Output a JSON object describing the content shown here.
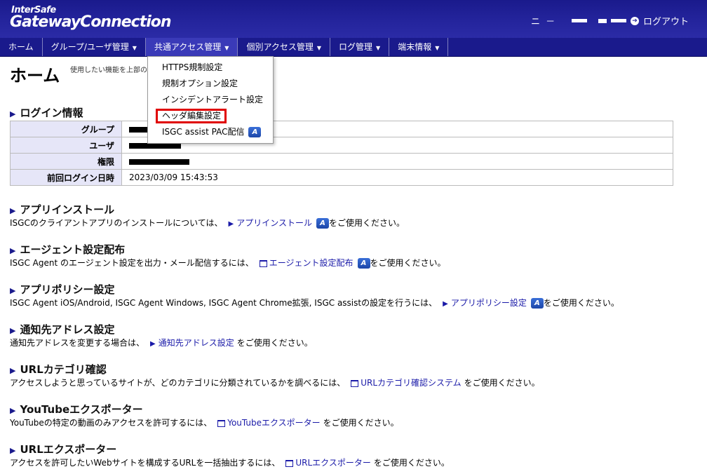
{
  "header": {
    "logo_top": "InterSafe",
    "logo_main": "GatewayConnection",
    "user_text": "ニ －",
    "logout": "ログアウト"
  },
  "nav": {
    "items": [
      {
        "label": "ホーム"
      },
      {
        "label": "グループ/ユーザ管理"
      },
      {
        "label": "共通アクセス管理"
      },
      {
        "label": "個別アクセス管理"
      },
      {
        "label": "ログ管理"
      },
      {
        "label": "端末情報"
      }
    ]
  },
  "dropdown": {
    "items": [
      {
        "label": "HTTPS規制設定"
      },
      {
        "label": "規制オプション設定"
      },
      {
        "label": "インシデントアラート設定"
      },
      {
        "label": "ヘッダ編集設定"
      },
      {
        "label": "ISGC assist PAC配信"
      }
    ]
  },
  "page": {
    "title": "ホーム",
    "desc": "使用したい機能を上部のメ"
  },
  "login": {
    "heading": "ログイン情報",
    "rows": [
      {
        "label": "グループ",
        "value": ""
      },
      {
        "label": "ユーザ",
        "value": ""
      },
      {
        "label": "権限",
        "value": ""
      },
      {
        "label": "前回ログイン日時",
        "value": "2023/03/09 15:43:53"
      }
    ]
  },
  "sections": [
    {
      "heading": "アプリインストール",
      "pre": "ISGCのクライアントアプリのインストールについては、",
      "link": "アプリインストール",
      "post": "をご使用ください。"
    },
    {
      "heading": "エージェント設定配布",
      "pre": "ISGC Agent のエージェント設定を出力・メール配信するには、",
      "link": "エージェント設定配布",
      "post": "をご使用ください。"
    },
    {
      "heading": "アプリポリシー設定",
      "pre": "ISGC Agent iOS/Android, ISGC Agent Windows, ISGC Agent Chrome拡張, ISGC assistの設定を行うには、",
      "link": "アプリポリシー設定",
      "post": "をご使用ください。"
    },
    {
      "heading": "通知先アドレス設定",
      "pre": "通知先アドレスを変更する場合は、",
      "link": "通知先アドレス設定",
      "post": "をご使用ください。"
    },
    {
      "heading": "URLカテゴリ確認",
      "pre": "アクセスしようと思っているサイトが、どのカテゴリに分類されているかを調べるには、",
      "link": "URLカテゴリ確認システム",
      "post": "をご使用ください。"
    },
    {
      "heading": "YouTubeエクスポーター",
      "pre": "YouTubeの特定の動画のみアクセスを許可するには、",
      "link": "YouTubeエクスポーター",
      "post": "をご使用ください。"
    },
    {
      "heading": "URLエクスポーター",
      "pre": "アクセスを許可したいWebサイトを構成するURLを一括抽出するには、",
      "link": "URLエクスポーター",
      "post": "をご使用ください。"
    }
  ]
}
